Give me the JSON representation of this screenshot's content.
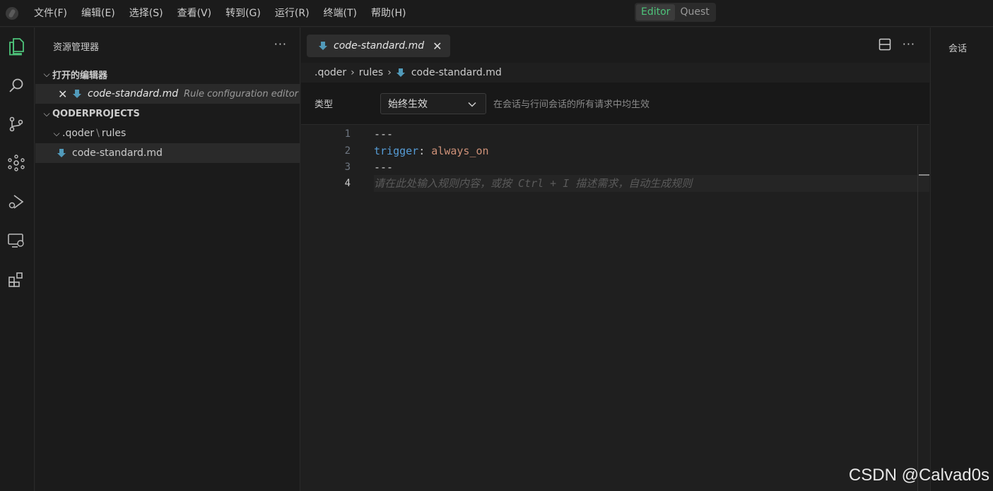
{
  "menu": [
    "文件(F)",
    "编辑(E)",
    "选择(S)",
    "查看(V)",
    "转到(G)",
    "运行(R)",
    "终端(T)",
    "帮助(H)"
  ],
  "mode_switch": {
    "editor": "Editor",
    "quest": "Quest",
    "active": "Editor"
  },
  "activity_icons": [
    "explorer-icon",
    "search-icon",
    "source-control-icon",
    "graph-icon",
    "run-debug-icon",
    "remote-icon",
    "extensions-icon"
  ],
  "sidebar": {
    "title": "资源管理器",
    "more": "···",
    "open_editors": {
      "label": "打开的编辑器",
      "items": [
        {
          "name": "code-standard.md",
          "description": "Rule configuration editor"
        }
      ]
    },
    "project": {
      "label": "QODERPROJECTS",
      "folder": ".qoder",
      "folder_sep": "\\",
      "subfolder": "rules",
      "file": "code-standard.md"
    }
  },
  "editor": {
    "tab": {
      "label": "code-standard.md"
    },
    "breadcrumb": [
      ".qoder",
      "rules",
      "code-standard.md"
    ],
    "rule": {
      "type_label": "类型",
      "type_value": "始终生效",
      "type_desc": "在会话与行间会话的所有请求中均生效"
    },
    "line_numbers": [
      "1",
      "2",
      "3",
      "4"
    ],
    "lines": {
      "l1": "---",
      "l2_key": "trigger",
      "l2_colon": ": ",
      "l2_val": "always_on",
      "l3": "---",
      "l4_placeholder": "请在此处输入规则内容，或按 Ctrl + I 描述需求，自动生成规则"
    }
  },
  "right_panel": {
    "title": "会话"
  },
  "watermark": "CSDN @Calvad0s",
  "colors": {
    "accent": "#4ec37a",
    "md_icon": "#519aba",
    "keyword": "#569cd6",
    "string": "#ce9178"
  }
}
